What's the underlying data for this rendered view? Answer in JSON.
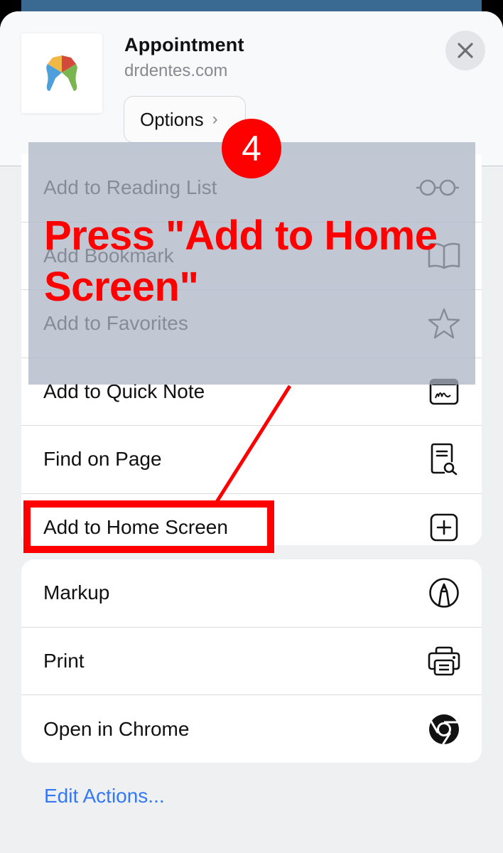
{
  "header": {
    "title": "Appointment",
    "domain": "drdentes.com",
    "options_label": "Options",
    "options_chevron": "›",
    "close_icon": "close-icon",
    "app_icon": "drdentes-tooth-logo"
  },
  "actions_group_1": [
    {
      "label": "Add to Reading List",
      "icon": "glasses-icon"
    },
    {
      "label": "Add Bookmark",
      "icon": "book-icon"
    },
    {
      "label": "Add to Favorites",
      "icon": "star-icon"
    },
    {
      "label": "Add to Quick Note",
      "icon": "quick-note-icon"
    },
    {
      "label": "Find on Page",
      "icon": "find-on-page-icon"
    },
    {
      "label": "Add to Home Screen",
      "icon": "add-square-icon"
    }
  ],
  "actions_group_2": [
    {
      "label": "Markup",
      "icon": "markup-icon"
    },
    {
      "label": "Print",
      "icon": "printer-icon"
    },
    {
      "label": "Open in Chrome",
      "icon": "chrome-icon"
    }
  ],
  "footer": {
    "edit_actions_label": "Edit Actions..."
  },
  "annotation": {
    "step_number": "4",
    "instruction": "Press \"Add to Home Screen\"",
    "highlight_target": "Add to Home Screen",
    "color": "#ff0000"
  },
  "colors": {
    "link_blue": "#3478f6",
    "background_card": "#3a6a91",
    "logo_yellow": "#f2b846",
    "logo_red": "#d34a3c",
    "logo_blue": "#4ea0dc",
    "logo_green": "#7ab650"
  }
}
